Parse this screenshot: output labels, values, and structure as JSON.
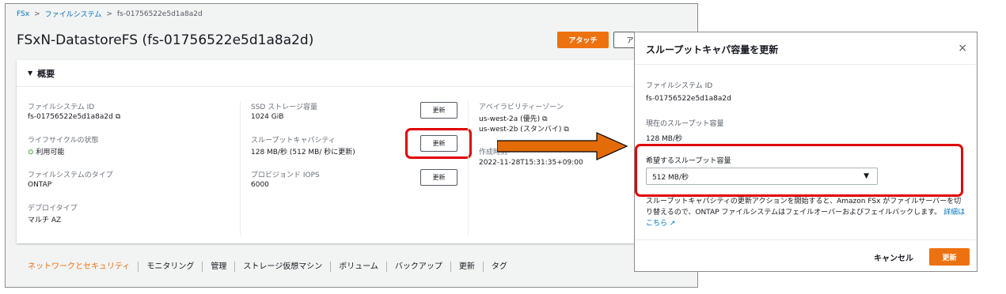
{
  "breadcrumb": {
    "root": "FSx",
    "sep": ">",
    "section": "ファイルシステム",
    "current": "fs-01756522e5d1a8a2d"
  },
  "page_title": "FSxN-DatastoreFS (fs-01756522e5d1a8a2d)",
  "header_buttons": {
    "attach": "アタッチ",
    "other": "ア"
  },
  "summary": {
    "heading": "概要",
    "toggle": "▼",
    "fs_id_label": "ファイルシステム ID",
    "fs_id_value": "fs-01756522e5d1a8a2d",
    "lifecycle_label": "ライフサイクルの状態",
    "lifecycle_value": "利用可能",
    "fs_type_label": "ファイルシステムのタイプ",
    "fs_type_value": "ONTAP",
    "deploy_label": "デプロイタイプ",
    "deploy_value": "マルチ AZ",
    "ssd_label": "SSD ストレージ容量",
    "ssd_value": "1024 GiB",
    "tp_label": "スループットキャパシティ",
    "tp_value": "128 MB/秒 (512 MB/ 秒に更新)",
    "iops_label": "プロビジョンド IOPS",
    "iops_value": "6000",
    "update_btn": "更新",
    "az_label": "アベイラビリティーゾーン",
    "az_value1": "us-west-2a (優先)",
    "az_value2": "us-west-2b (スタンバイ)",
    "created_label": "作成時刻",
    "created_value": "2022-11-28T15:31:35+09:00"
  },
  "tabs": [
    "ネットワークとセキュリティ",
    "モニタリング",
    "管理",
    "ストレージ仮想マシン",
    "ボリューム",
    "バックアップ",
    "更新",
    "タグ"
  ],
  "modal": {
    "title": "スループットキャパ容量を更新",
    "close": "×",
    "fs_id_label": "ファイルシステム ID",
    "fs_id_value": "fs-01756522e5d1a8a2d",
    "current_label": "現在のスループット容量",
    "current_value": "128 MB/秒",
    "desired_label": "希望するスループット容量",
    "desired_value": "512 MB/秒",
    "note": "スループットキャパシティの更新アクションを開始すると、Amazon FSx がファイルサーバーを切り替えるので、ONTAP ファイルシステムはフェイルオーバーおよびフェイルバックします。",
    "note_link": "詳細はこちら",
    "cancel": "キャンセル",
    "update": "更新"
  },
  "colors": {
    "accent": "#ec7211",
    "link": "#0073bb",
    "highlight": "#e00000",
    "arrow": "#e36c09",
    "success": "#1d8102"
  }
}
